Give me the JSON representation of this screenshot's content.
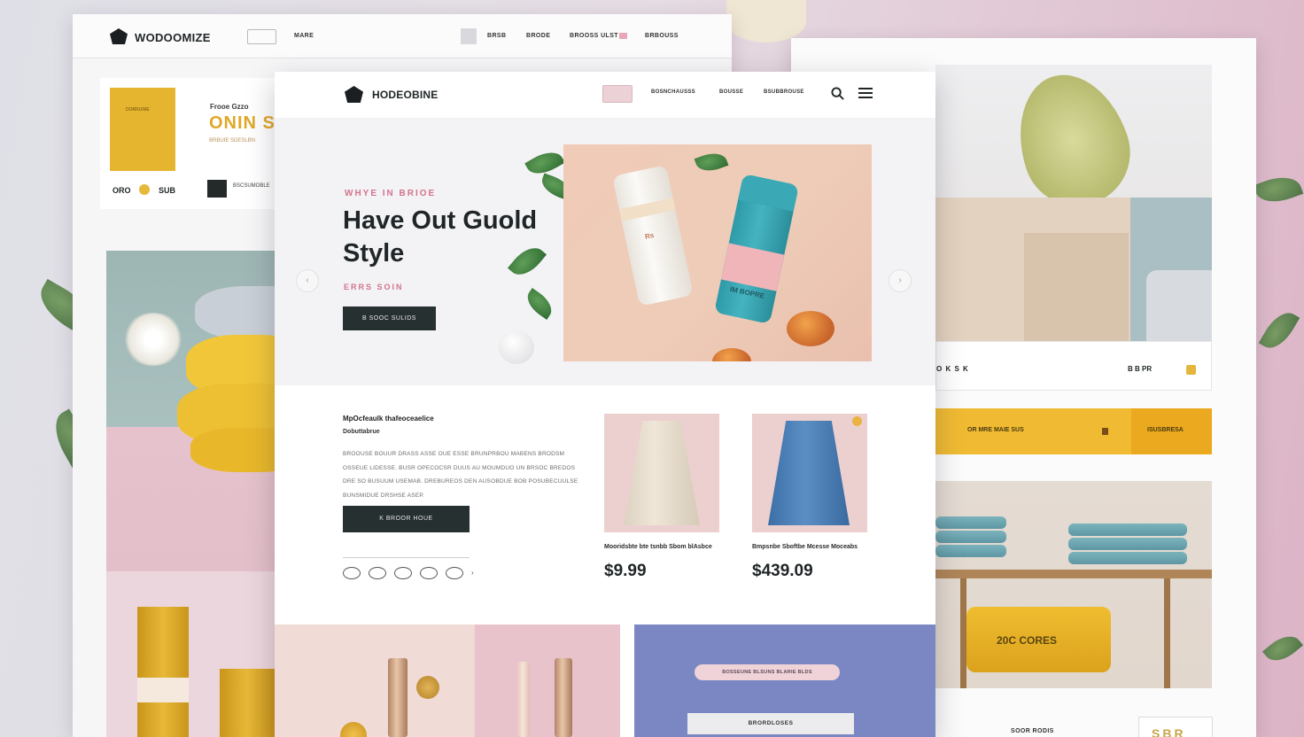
{
  "left_page": {
    "logo": "WODOOMIZE",
    "nav_links": [
      "MARE",
      "BRSB",
      "BRODE",
      "BROOSS ULST",
      "BRBOUSS"
    ],
    "card": {
      "eyebrow": "Frooe Gzzo",
      "headline": "ONIN S",
      "subline": "BRBUIE SDESLBN",
      "book_tag": "DORRUNIE",
      "price": "ORO",
      "size": "SUB",
      "button_label": "BSCSUMOBLE"
    }
  },
  "right_page": {
    "strip_left": "O K S K",
    "strip_right": "B B PR",
    "yellow_left": "OR  MRE MAIE  SUS",
    "yellow_right": "ISUSBRESA",
    "pillow_text": "20C CORES",
    "bottom_label": "SOOR RODIS",
    "bottom_box_text": "SBR"
  },
  "front_page": {
    "nav": {
      "logo": "HODEOBINE",
      "links": [
        "BOSNCHAUSSS",
        "BOUSSE",
        "BSUBBROUSE"
      ]
    },
    "hero": {
      "eyebrow": "WHYE IN BRIOE",
      "title": "Have Out Guold Style",
      "subtitle": "ERRS SOIN",
      "cta": "B SOOC SULIDS",
      "prev_arrow": "‹",
      "next_arrow": "›",
      "tube_white_text": "Rs",
      "tube_teal_text": "IM BOPRE"
    },
    "section": {
      "title": "MpOcfeaulk thafeoceaelice",
      "subtitle": "Dobuttabrue",
      "body": "BROOUSE BOUUR DRASS ASSE OUE ESSE BRUNPRBOU MABENS BRODSM OSSEUE LIDESSE. BUSR OPECOCSR DUUS AU MOUMDUO UN BRSOC BREDOS DRE SO BUSUUM USEMAB. DREBUREOS DEN AUSOBDUE BOB POSUBECUULSE BUNSMIDUE DRSHSE ASEP.",
      "cta": "K BROOR HOUE",
      "dots_more": "›"
    },
    "products": [
      {
        "name": "Mooridsbte bte tsnbb Sbom blAsbce",
        "price": "$9.99"
      },
      {
        "name": "Bmpsnbe Sboftbe Mcesse Moceabs",
        "price": "$439.09"
      }
    ],
    "tiles": {
      "pill_text": "BOSSEUNE  BLSUNS  BLARIE  BLDS",
      "button_label": "BRORDLOSES"
    }
  }
}
